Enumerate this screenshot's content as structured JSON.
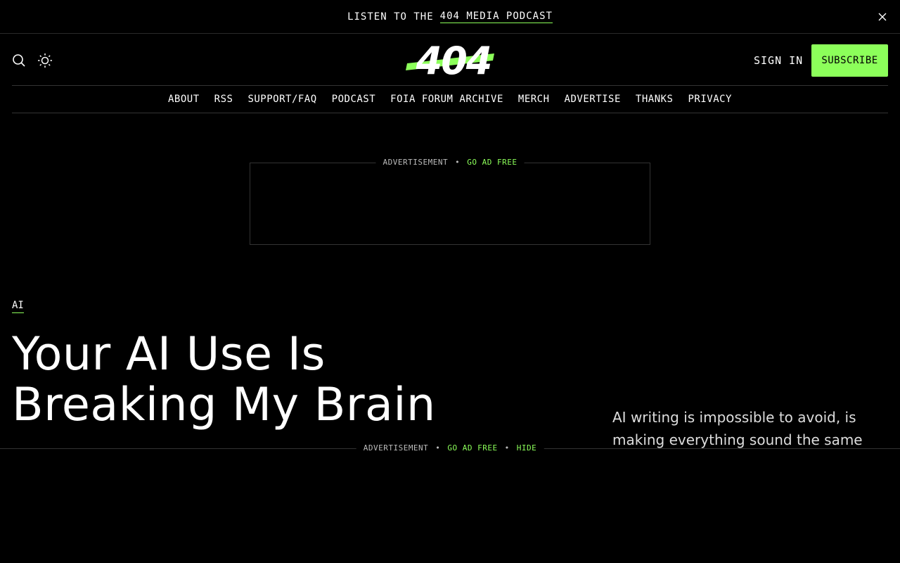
{
  "topbar": {
    "prefix": "LISTEN TO THE",
    "link": "404 MEDIA PODCAST"
  },
  "header": {
    "logo": "404",
    "signin": "SIGN IN",
    "subscribe": "SUBSCRIBE"
  },
  "nav": {
    "items": [
      "ABOUT",
      "RSS",
      "SUPPORT/FAQ",
      "PODCAST",
      "FOIA FORUM ARCHIVE",
      "MERCH",
      "ADVERTISE",
      "THANKS",
      "PRIVACY"
    ]
  },
  "ad_top": {
    "label": "ADVERTISEMENT",
    "sep": "•",
    "go_ad_free": "GO AD FREE"
  },
  "article": {
    "tag": "AI",
    "title_line1": "Your AI Use Is",
    "title_line2": "Breaking My Brain",
    "dek_line1": "AI writing is impossible to avoid, is",
    "dek_line2": "making everything sound the same"
  },
  "ad_bottom": {
    "label": "ADVERTISEMENT",
    "sep": "•",
    "go_ad_free": "GO AD FREE",
    "hide": "HIDE"
  },
  "colors": {
    "accent": "#8cff5a",
    "background": "#000000",
    "text": "#ffffff"
  },
  "icons": [
    "search-icon",
    "sun-icon",
    "close-icon"
  ]
}
